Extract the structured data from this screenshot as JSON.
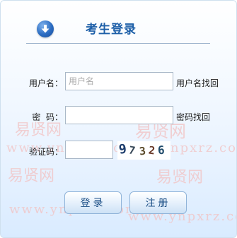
{
  "header": {
    "title": "考生登录",
    "icon": "down-arrow-circle-icon"
  },
  "form": {
    "username": {
      "label": "用户名：",
      "placeholder": "用户名",
      "value": "",
      "link": "用户名找回"
    },
    "password": {
      "label": "密  码：",
      "value": "",
      "link": "密码找回"
    },
    "captcha": {
      "label": "验证码：",
      "value": "",
      "image_text": [
        "9",
        "7",
        "3",
        "2",
        "6"
      ]
    }
  },
  "buttons": {
    "login": "登录",
    "register": "注册"
  },
  "watermark": {
    "cn": "易贤网",
    "url": "www.ynpxrz.com"
  },
  "colors": {
    "title": "#1d5fa8",
    "button_text": "#1c4f86",
    "accent": "#2b6cc2"
  }
}
